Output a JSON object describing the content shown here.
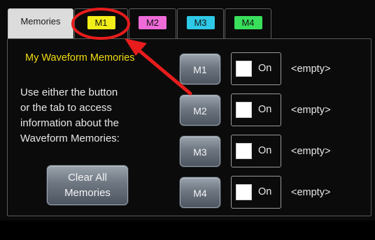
{
  "tabs": [
    {
      "label": "Memories",
      "active": true
    },
    {
      "label": "M1",
      "color": "#f2ee1a"
    },
    {
      "label": "M2",
      "color": "#ee6bd8"
    },
    {
      "label": "M3",
      "color": "#2ec9e6"
    },
    {
      "label": "M4",
      "color": "#39e05c"
    }
  ],
  "panel": {
    "title": "My Waveform Memories",
    "help_lines": [
      "Use either the button",
      "or the tab to access",
      "information about the",
      "Waveform Memories:"
    ],
    "clear_button": {
      "line1": "Clear All",
      "line2": "Memories"
    }
  },
  "memories": [
    {
      "button": "M1",
      "toggle_label": "On",
      "checked": false,
      "status": "<empty>"
    },
    {
      "button": "M2",
      "toggle_label": "On",
      "checked": false,
      "status": "<empty>"
    },
    {
      "button": "M3",
      "toggle_label": "On",
      "checked": false,
      "status": "<empty>"
    },
    {
      "button": "M4",
      "toggle_label": "On",
      "checked": false,
      "status": "<empty>"
    }
  ],
  "annotation": {
    "highlight_color": "#e81c1c"
  },
  "colors": {
    "title_yellow": "#f2dc12",
    "panel_bg": "#0b0b0b"
  }
}
